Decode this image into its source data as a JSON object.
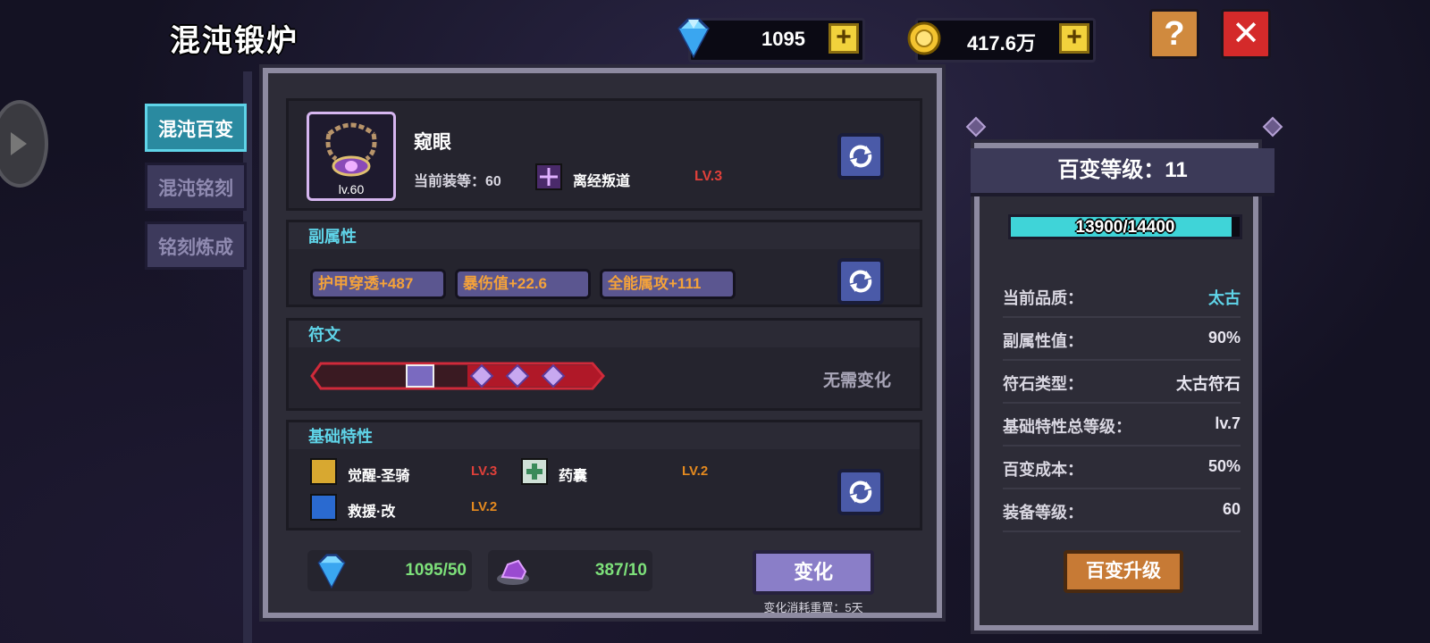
{
  "header": {
    "title": "混沌锻炉",
    "gems": "1095",
    "gold": "417.6万",
    "help_label": "?",
    "close_label": "✕"
  },
  "tabs": [
    {
      "label": "混沌百变",
      "active": true
    },
    {
      "label": "混沌铭刻",
      "active": false
    },
    {
      "label": "铭刻炼成",
      "active": false
    }
  ],
  "item": {
    "name": "窥眼",
    "slot_level": "lv.60",
    "equip_level_label": "当前装等：60",
    "effect_name": "离经叛道",
    "effect_level": "LV.3"
  },
  "sub_attributes": {
    "title": "副属性",
    "items": [
      "护甲穿透+487",
      "暴伤值+22.6",
      "全能属攻+111"
    ]
  },
  "runes": {
    "title": "符文",
    "status": "无需变化"
  },
  "base_traits": {
    "title": "基础特性",
    "items": [
      {
        "name": "觉醒-圣骑",
        "level": "LV.3",
        "level_color": "#e0403a"
      },
      {
        "name": "药囊",
        "level": "LV.2",
        "level_color": "#e58a1f"
      },
      {
        "name": "救援·改",
        "level": "LV.2",
        "level_color": "#e58a1f"
      }
    ]
  },
  "cost": {
    "gems": "1095/50",
    "material": "387/10",
    "change_label": "变化",
    "reset_note": "变化消耗重置：5天"
  },
  "right_panel": {
    "title": "百变等级：11",
    "progress_text": "13900/14400",
    "progress_fraction": 0.965,
    "stats": [
      {
        "key": "当前品质：",
        "value": "太古",
        "highlight": true
      },
      {
        "key": "副属性值：",
        "value": "90%"
      },
      {
        "key": "符石类型：",
        "value": "太古符石"
      },
      {
        "key": "基础特性总等级：",
        "value": "lv.7"
      },
      {
        "key": "百变成本：",
        "value": "50%"
      },
      {
        "key": "装备等级：",
        "value": "60"
      }
    ],
    "upgrade_label": "百变升级"
  },
  "colors": {
    "accent_cyan": "#5fd4e8",
    "attr_orange": "#f4a23a",
    "cost_green": "#7de07a",
    "level_red": "#e0403a",
    "level_orange": "#e58a1f"
  }
}
